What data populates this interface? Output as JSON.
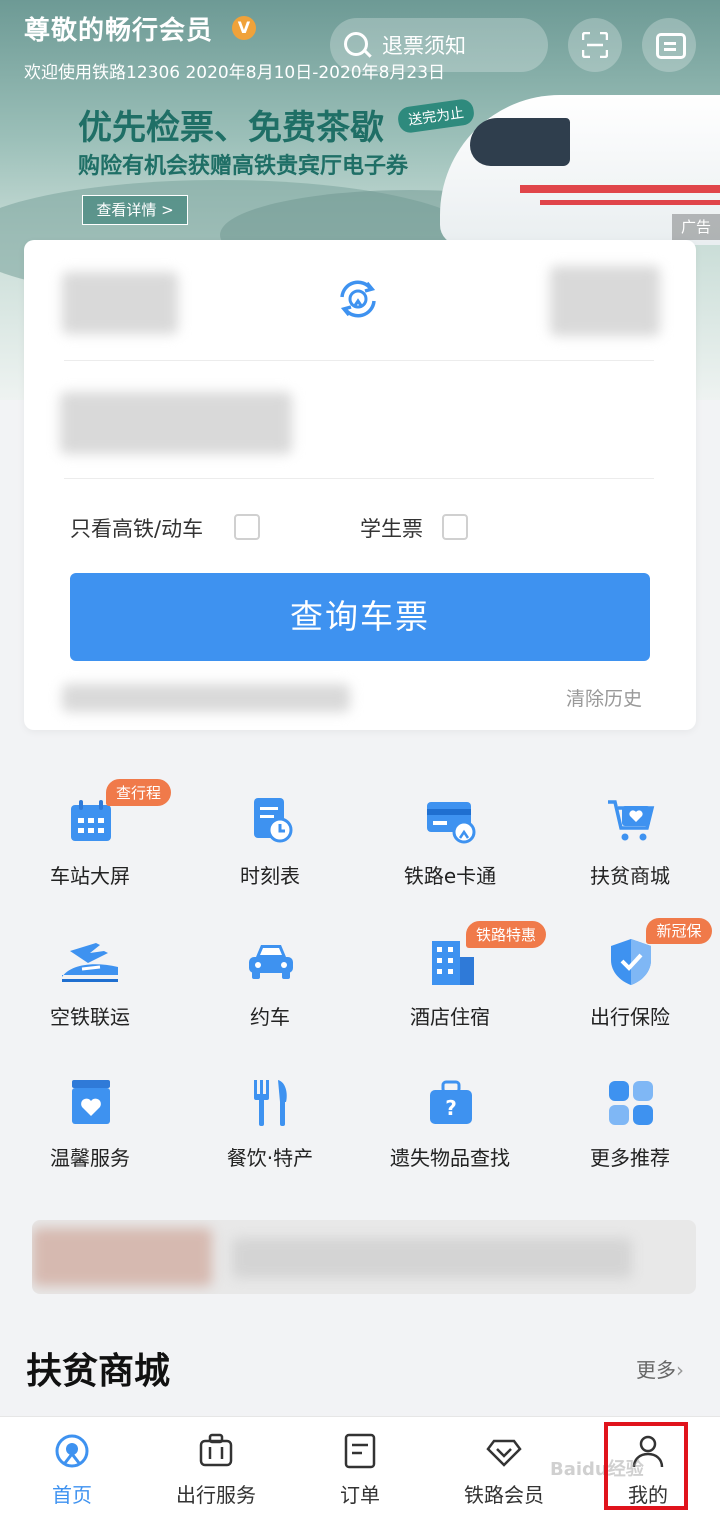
{
  "banner": {
    "member_title": "尊敬的畅行会员",
    "member_badge": "V",
    "member_sub": "欢迎使用铁路12306 2020年8月10日-2020年8月23日",
    "search_label": "退票须知",
    "promo_headline": "优先检票、免费茶歇",
    "promo_tag": "送完为止",
    "promo_sub": "购险有机会获赠高铁贵宾厅电子券",
    "promo_button": "查看详情 >",
    "ad_tag": "广告"
  },
  "booking": {
    "option_high_speed": "只看高铁/动车",
    "option_student": "学生票",
    "query_button": "查询车票",
    "clear_history": "清除历史"
  },
  "grid": [
    {
      "label": "车站大屏",
      "icon": "calendar-icon",
      "badge": "查行程"
    },
    {
      "label": "时刻表",
      "icon": "timetable-icon",
      "badge": ""
    },
    {
      "label": "铁路e卡通",
      "icon": "card-icon",
      "badge": ""
    },
    {
      "label": "扶贫商城",
      "icon": "cart-icon",
      "badge": ""
    },
    {
      "label": "空铁联运",
      "icon": "plane-train-icon",
      "badge": ""
    },
    {
      "label": "约车",
      "icon": "car-icon",
      "badge": ""
    },
    {
      "label": "酒店住宿",
      "icon": "hotel-icon",
      "badge": "铁路特惠"
    },
    {
      "label": "出行保险",
      "icon": "shield-icon",
      "badge": "新冠保"
    },
    {
      "label": "温馨服务",
      "icon": "heart-box-icon",
      "badge": ""
    },
    {
      "label": "餐饮·特产",
      "icon": "cutlery-icon",
      "badge": ""
    },
    {
      "label": "遗失物品查找",
      "icon": "lost-bag-icon",
      "badge": ""
    },
    {
      "label": "更多推荐",
      "icon": "apps-icon",
      "badge": ""
    }
  ],
  "section": {
    "title": "扶贫商城",
    "more": "更多"
  },
  "tabs": [
    {
      "label": "首页",
      "icon": "home-icon",
      "active": true
    },
    {
      "label": "出行服务",
      "icon": "luggage-icon",
      "active": false
    },
    {
      "label": "订单",
      "icon": "order-icon",
      "active": false
    },
    {
      "label": "铁路会员",
      "icon": "diamond-icon",
      "active": false
    },
    {
      "label": "我的",
      "icon": "person-icon",
      "active": false
    }
  ],
  "watermark": "Baidu经验",
  "colors": {
    "accent": "#3e92f0",
    "badge": "#f07a4a",
    "highlight": "#e0131c",
    "teal": "#1f6f66"
  }
}
